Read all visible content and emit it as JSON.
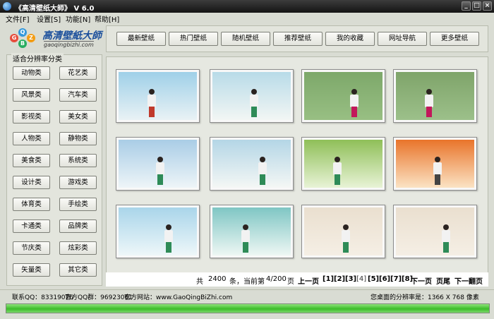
{
  "window": {
    "title": "《高清壁纸大師》 V 6.0",
    "controls": [
      "_",
      "□",
      "×"
    ]
  },
  "menu": [
    "文件[F]",
    "设置[S]",
    "功能[N]",
    "帮助[H]"
  ],
  "logo": {
    "balls": [
      "G",
      "Q",
      "B",
      "Z"
    ],
    "name": "高清壁紙大師",
    "site": "gaoqingbizhi.com"
  },
  "nav": [
    "最新壁纸",
    "热门壁纸",
    "随机壁纸",
    "推荐壁纸",
    "我的收藏",
    "网址导航",
    "更多壁纸"
  ],
  "sidebar": {
    "title": "适合分辨率分类",
    "categories": [
      [
        "动物类",
        "花艺类"
      ],
      [
        "风景类",
        "汽车类"
      ],
      [
        "影视类",
        "美女类"
      ],
      [
        "人物类",
        "静物类"
      ],
      [
        "美食类",
        "系统类"
      ],
      [
        "设计类",
        "游戏类"
      ],
      [
        "体育类",
        "手绘类"
      ],
      [
        "卡通类",
        "品牌类"
      ],
      [
        "节庆类",
        "炫彩类"
      ],
      [
        "矢量类",
        "其它类"
      ]
    ]
  },
  "gallery": {
    "thumbnails": [
      {
        "bg": [
          "#9fd0e8",
          "#e9f2f5"
        ],
        "accent": "#c0392b"
      },
      {
        "bg": [
          "#b8dbe8",
          "#f2f6f4"
        ],
        "accent": "#2e8b57"
      },
      {
        "bg": [
          "#7da86a",
          "#98bf83"
        ],
        "accent": "#c2185b"
      },
      {
        "bg": [
          "#7fa46a",
          "#9cc08a"
        ],
        "accent": "#c2185b"
      },
      {
        "bg": [
          "#a9cde6",
          "#eef5f8"
        ],
        "accent": "#2e8b57"
      },
      {
        "bg": [
          "#b4d6e6",
          "#f4f7f5"
        ],
        "accent": "#2e8b57"
      },
      {
        "bg": [
          "#8fbf58",
          "#e8f3d6"
        ],
        "accent": "#2e8b57"
      },
      {
        "bg": [
          "#e9742a",
          "#fbe3c4"
        ],
        "accent": "#444444"
      },
      {
        "bg": [
          "#a9d5ea",
          "#eef7f9"
        ],
        "accent": "#2e8b57"
      },
      {
        "bg": [
          "#7fc6c4",
          "#eef7f4"
        ],
        "accent": "#2e8b57"
      },
      {
        "bg": [
          "#eadfcf",
          "#f5efe5"
        ],
        "accent": "#2e8b57"
      },
      {
        "bg": [
          "#eadfcf",
          "#f5efe5"
        ],
        "accent": "#2e8b57"
      }
    ]
  },
  "pager": {
    "prefix": "共",
    "total": "2400",
    "middle": "条，当前第",
    "page": "4/200",
    "suffix": "页",
    "prev": "上一页",
    "pages": [
      "[1]",
      "[2]",
      "[3]",
      "[4]",
      "[5]",
      "[6]",
      "[7]",
      "[8]"
    ],
    "current_index": 3,
    "next": "下一页",
    "last": "页尾",
    "next_section": "下一翻页"
  },
  "status": {
    "qq": "联系QQ：83319076",
    "qq_group": "官方QQ群：96923061",
    "website": "官方网站：www.GaoQingBiZhi.com",
    "resolution": "您桌面的分辨率是：1366 X 768 像素"
  },
  "progress": {
    "value": 1.0,
    "color": "#3cbc2a"
  }
}
